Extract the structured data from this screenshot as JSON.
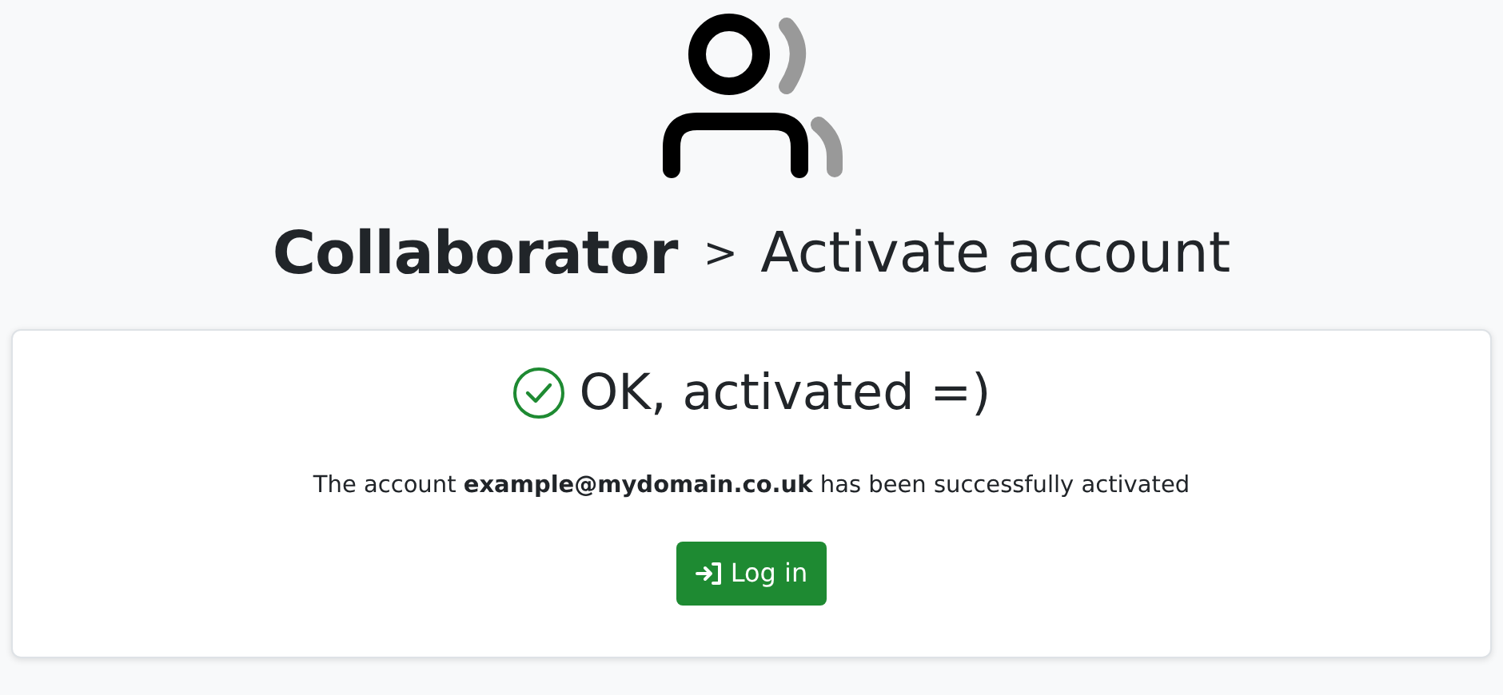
{
  "header": {
    "brand": "Collaborator",
    "separator": ">",
    "page_title": "Activate account"
  },
  "card": {
    "status": "OK, activated =)",
    "message": "The account **example@mydomain.co.uk** has been successfully activated",
    "button": "Log in"
  }
}
